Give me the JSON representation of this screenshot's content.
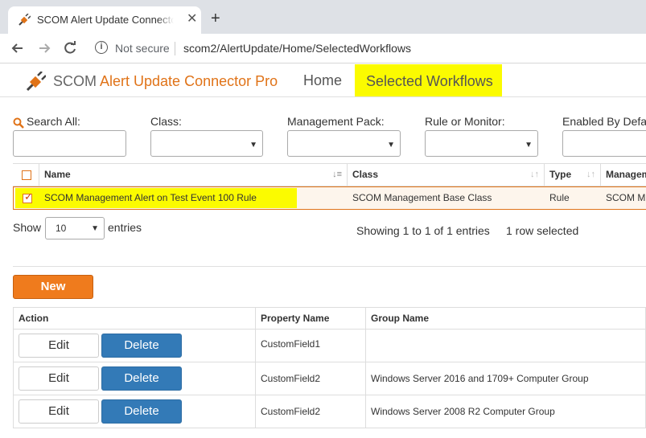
{
  "browser": {
    "tab_title": "SCOM Alert Update Connector Pro",
    "close_glyph": "✕",
    "new_tab_glyph": "+",
    "not_secure": "Not secure",
    "url": "scom2/AlertUpdate/Home/SelectedWorkflows"
  },
  "app": {
    "brand_prefix": "SCOM ",
    "brand_accent": "Alert Update Connector Pro",
    "accent_color": "#e07318",
    "nav": {
      "home": "Home",
      "selected": "Selected Workflows"
    }
  },
  "filters": {
    "search_all": "Search All:",
    "class": "Class:",
    "management_pack": "Management Pack:",
    "rule_or_monitor": "Rule or Monitor:",
    "enabled_by_default": "Enabled By Defa"
  },
  "grid": {
    "headers": {
      "name": "Name",
      "class": "Class",
      "type": "Type",
      "management": "Managem"
    },
    "rows": [
      {
        "name": "SCOM Management Alert on Test Event 100 Rule",
        "class": "SCOM Management Base Class",
        "type": "Rule",
        "management": "SCOM M"
      }
    ],
    "show_label": "Show",
    "show_value": "10",
    "entries_label": "entries",
    "info": "Showing 1 to 1 of 1 entries",
    "selected_info": "1 row selected"
  },
  "new_button": "New",
  "properties": {
    "headers": {
      "action": "Action",
      "property": "Property Name",
      "group": "Group Name"
    },
    "edit_label": "Edit",
    "delete_label": "Delete",
    "rows": [
      {
        "property": "CustomField1",
        "group": ""
      },
      {
        "property": "CustomField2",
        "group": "Windows Server 2016 and 1709+ Computer Group"
      },
      {
        "property": "CustomField2",
        "group": "Windows Server 2008 R2 Computer Group"
      }
    ]
  }
}
